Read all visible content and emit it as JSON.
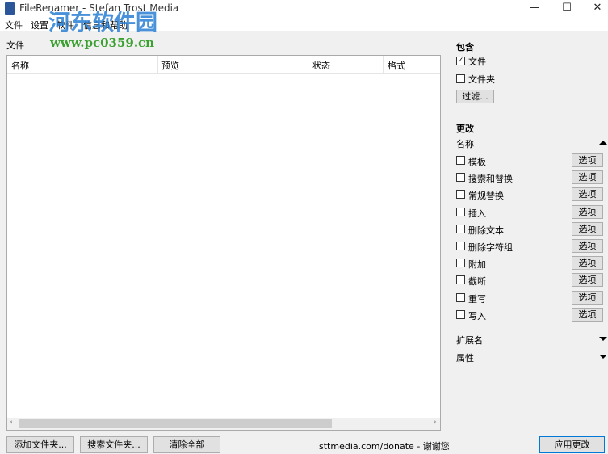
{
  "window": {
    "title": "FileRenamer - Stefan Trost Media",
    "minimize": "—",
    "maximize": "☐",
    "close": "✕"
  },
  "menu": [
    "文件",
    "设置",
    "软件",
    "信息和帮助"
  ],
  "watermark": {
    "name": "河东软件园",
    "url": "www.pc0359.cn"
  },
  "files": {
    "label": "文件",
    "columns": [
      "名称",
      "预览",
      "状态",
      "格式"
    ],
    "rows": []
  },
  "buttons": {
    "add_folder": "添加文件夹...",
    "search_folder": "搜索文件夹...",
    "clear_all": "清除全部",
    "apply": "应用更改"
  },
  "donate": "sttmedia.com/donate - 谢谢您",
  "include": {
    "title": "包含",
    "items": [
      {
        "label": "文件",
        "checked": true
      },
      {
        "label": "文件夹",
        "checked": false
      }
    ],
    "filter": "过滤..."
  },
  "change": {
    "title": "更改",
    "name_section": "名称",
    "options_label": "选项",
    "items": [
      {
        "label": "模板",
        "checked": false
      },
      {
        "label": "搜索和替换",
        "checked": false
      },
      {
        "label": "常规替换",
        "checked": false
      },
      {
        "label": "插入",
        "checked": false
      },
      {
        "label": "删除文本",
        "checked": false
      },
      {
        "label": "删除字符组",
        "checked": false
      },
      {
        "label": "附加",
        "checked": false
      },
      {
        "label": "截断",
        "checked": false
      },
      {
        "label": "重写",
        "checked": false
      },
      {
        "label": "写入",
        "checked": false
      }
    ],
    "extension": "扩展名",
    "attributes": "属性"
  }
}
